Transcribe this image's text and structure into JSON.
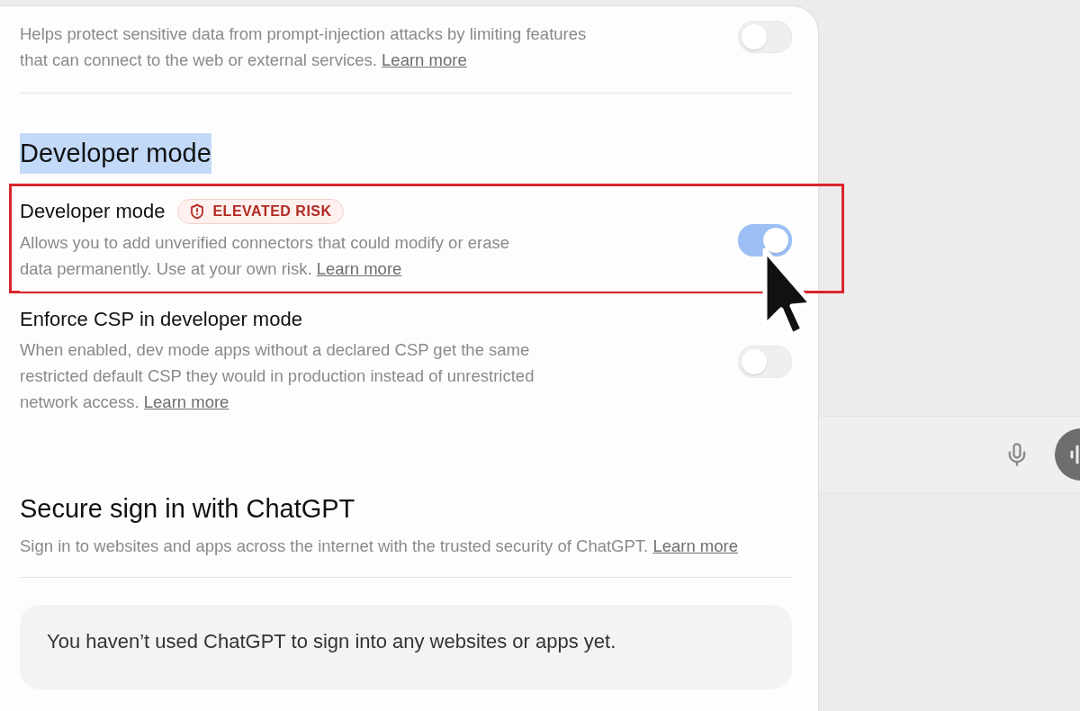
{
  "top_setting": {
    "description": "Helps protect sensitive data from prompt-injection attacks by limiting features that can connect to the web or external services.",
    "link": "Learn more",
    "on": false
  },
  "developer_mode": {
    "heading": "Developer mode",
    "highlighted": true,
    "settings": [
      {
        "title": "Developer mode",
        "badge": "ELEVATED RISK",
        "description": "Allows you to add unverified connectors that could modify or erase data permanently. Use at your own risk.",
        "link": "Learn more",
        "on": true,
        "outlined": true
      },
      {
        "title": "Enforce CSP in developer mode",
        "description": "When enabled, dev mode apps without a declared CSP get the same restricted default CSP they would in production instead of unrestricted network access.",
        "link": "Learn more",
        "on": false,
        "outlined": false
      }
    ]
  },
  "secure_sign_in": {
    "heading": "Secure sign in with ChatGPT",
    "description": "Sign in to websites and apps across the internet with the trusted security of ChatGPT.",
    "link": "Learn more",
    "empty_message": "You haven’t used ChatGPT to sign into any websites or apps yet."
  }
}
